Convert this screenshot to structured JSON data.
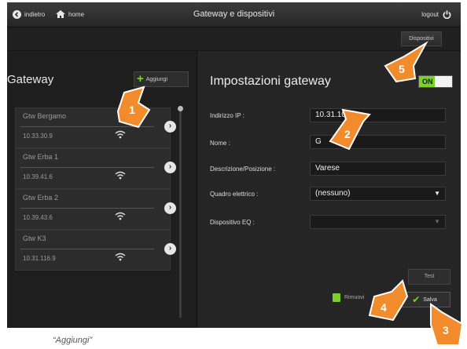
{
  "topbar": {
    "back_label": "indietro",
    "home_label": "home",
    "title": "Gateway e dispositivi",
    "logout_label": "logout"
  },
  "subbar": {
    "devices_button": "Dispositivi"
  },
  "left": {
    "title": "Gateway",
    "add_label": "Aggiungi",
    "gateways": [
      {
        "name": "Gtw Bergamo",
        "ip": "10.33.30.9"
      },
      {
        "name": "Gtw Erba 1",
        "ip": "10.39.41.6"
      },
      {
        "name": "Gtw Erba 2",
        "ip": "10.39.43.6"
      },
      {
        "name": "Gtw K3",
        "ip": "10.31.116.9"
      }
    ]
  },
  "right": {
    "title": "Impostazioni gateway",
    "toggle_label": "ON",
    "fields": {
      "ip_label": "Indirizzo IP :",
      "ip_value": "10.31.100.8",
      "name_label": "Nome :",
      "name_value": "G",
      "desc_label": "Descrizione/Posizione :",
      "desc_value": "Varese",
      "quadro_label": "Quadro elettrico :",
      "quadro_value": "(nessuno)",
      "eq_label": "Dispositivo EQ :",
      "eq_value": ""
    },
    "test_label": "Test",
    "remove_label": "Rimuovi",
    "save_label": "Salva"
  },
  "callouts": [
    "1",
    "2",
    "3",
    "4",
    "5"
  ],
  "footer_text": "“Aggiungi”",
  "colors": {
    "accent": "#7bd12b",
    "callout": "#f28b2c"
  }
}
